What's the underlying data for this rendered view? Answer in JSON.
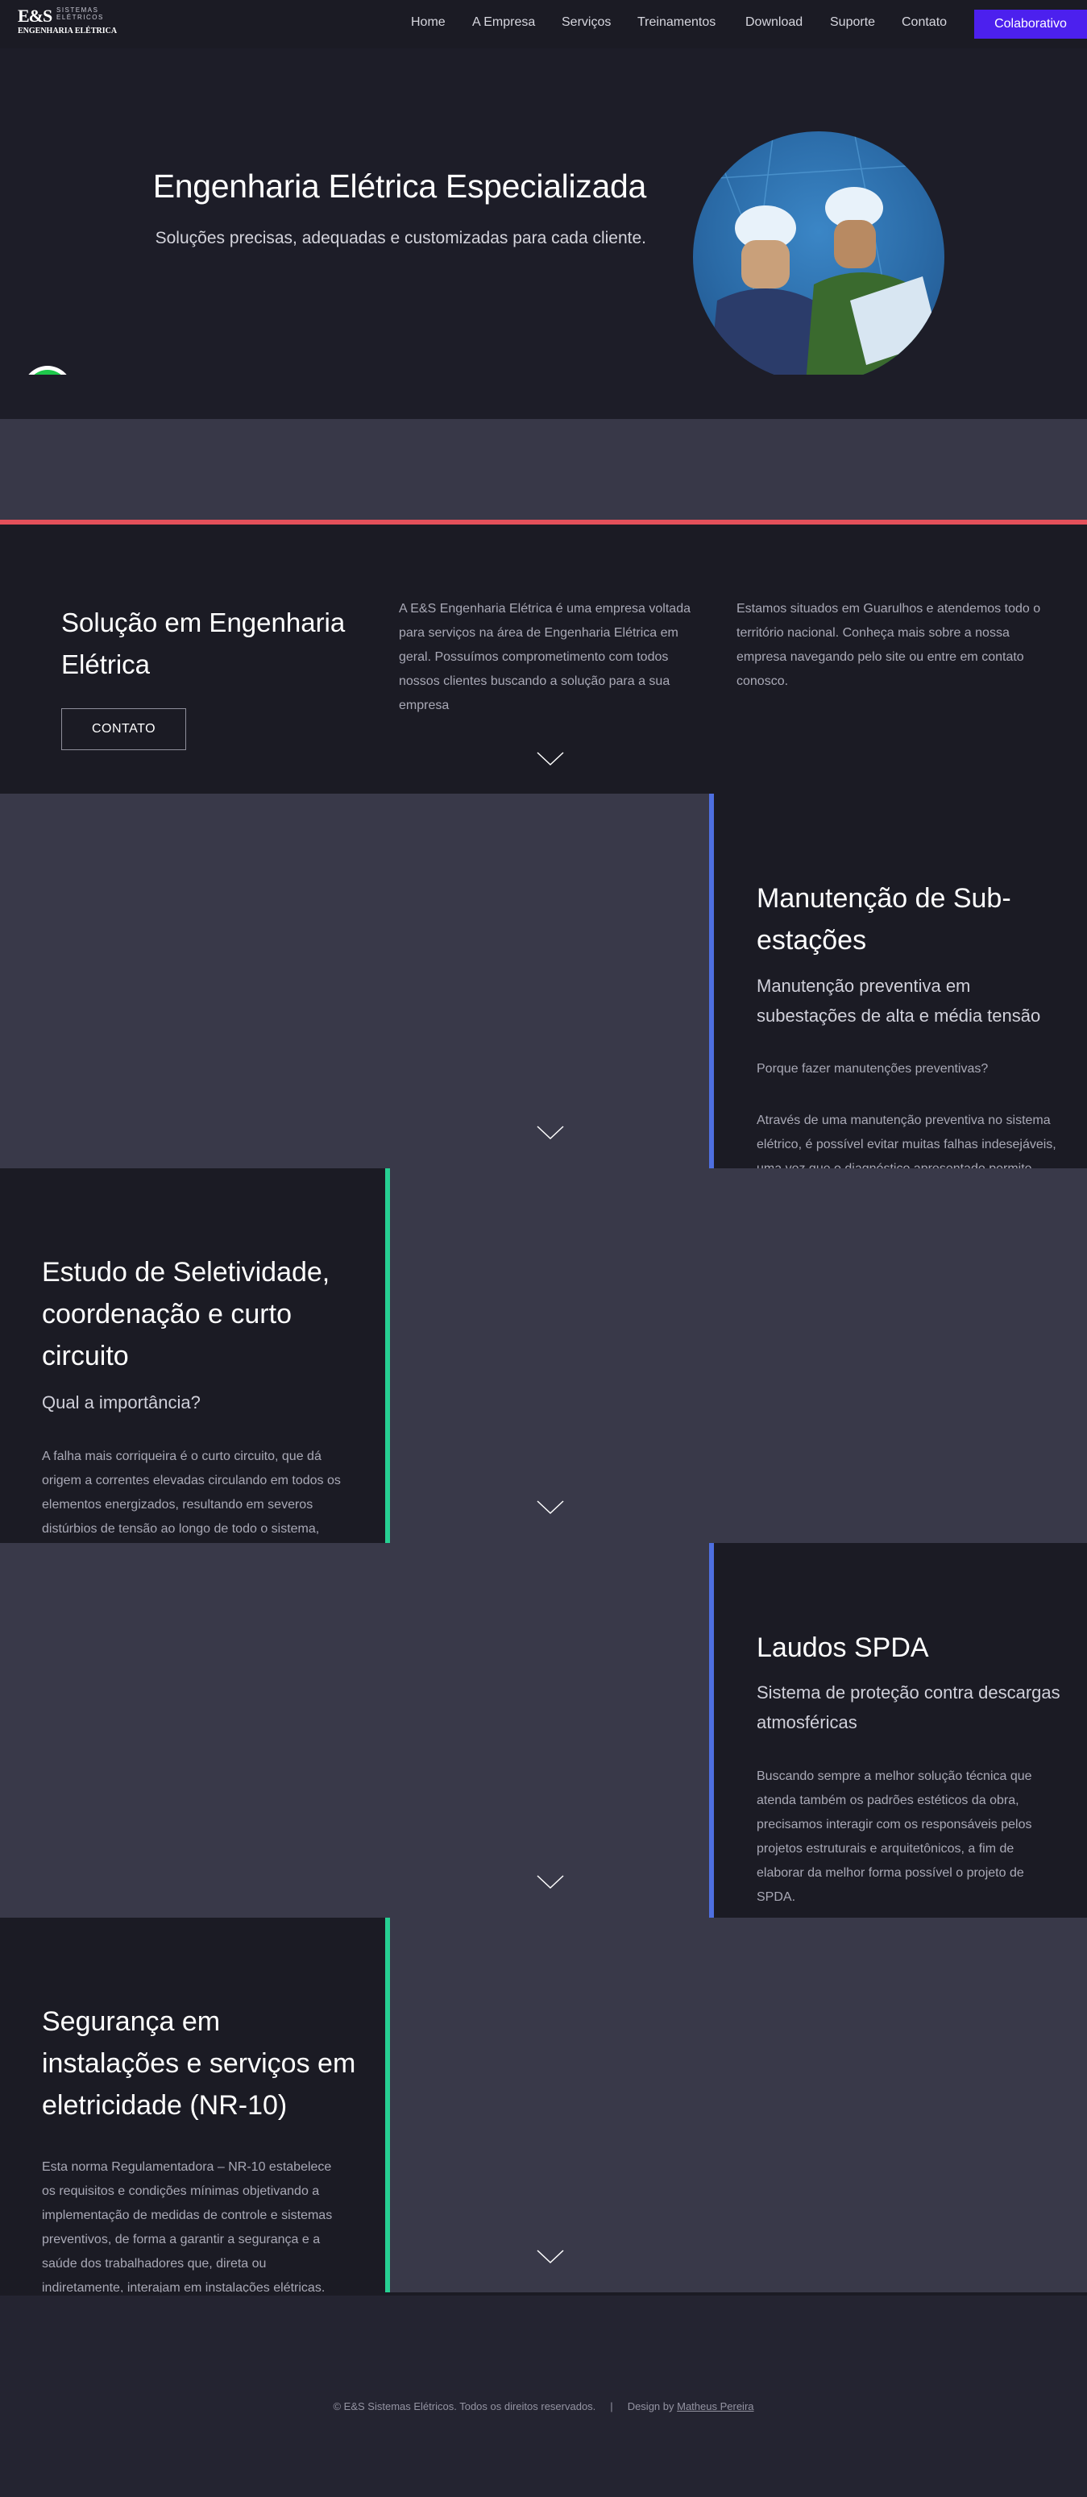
{
  "brand": {
    "logo_main": "E&S",
    "logo_line1": "SISTEMAS",
    "logo_line2": "ELÉTRICOS",
    "logo_tagline": "ENGENHARIA ELÉTRICA"
  },
  "nav": {
    "items": [
      "Home",
      "A Empresa",
      "Serviços",
      "Treinamentos",
      "Download",
      "Suporte",
      "Contato"
    ],
    "cta": "Colaborativo"
  },
  "hero": {
    "title": "Engenharia Elétrica Especializada",
    "subtitle": "Soluções precisas, adequadas e customizadas para cada cliente."
  },
  "solution": {
    "title": "Solução em Engenharia Elétrica",
    "button": "CONTATO",
    "col1": "A E&S Engenharia Elétrica é uma empresa voltada para serviços na área de Engenharia Elétrica em geral. Possuímos comprometimento com todos nossos clientes buscando a solução para a sua empresa",
    "col2": "Estamos situados em Guarulhos e atendemos todo o território nacional. Conheça mais sobre a nossa empresa navegando pelo site ou entre em contato conosco."
  },
  "services": [
    {
      "title": "Manutenção de Sub-estações",
      "subtitle": "Manutenção preventiva em subestações de alta e média tensão",
      "question": "Porque fazer manutenções preventivas?",
      "text": "Através de uma manutenção preventiva no sistema elétrico, é possível evitar muitas falhas indesejáveis, uma vez que o diagnóstico apresentado permite corrigir problemas antes que se tornem graves."
    },
    {
      "title": "Estudo de Seletividade, coordenação e curto circuito",
      "subtitle": "Qual a importância?",
      "text": "A falha mais corriqueira é o curto circuito, que dá origem a correntes elevadas circulando em todos os elementos energizados, resultando em severos distúrbios de tensão ao longo de todo o sistema, podendo causar danos irreparáveis."
    },
    {
      "title": "Laudos SPDA",
      "subtitle": "Sistema de proteção contra descargas atmosféricas",
      "text": "Buscando sempre a melhor solução técnica que atenda também os padrões estéticos da obra, precisamos interagir com os responsáveis pelos projetos estruturais e arquitetônicos, a fim de elaborar da melhor forma possível o projeto de SPDA."
    },
    {
      "title": "Segurança em instalações e serviços em eletricidade (NR-10)",
      "text": "Esta norma Regulamentadora – NR-10 estabelece os requisitos e condições mínimas objetivando a implementação de medidas de controle e sistemas preventivos, de forma a garantir a segurança e a saúde dos trabalhadores que, direta ou indiretamente, interajam em instalações elétricas."
    }
  ],
  "footer": {
    "copyright": "© E&S Sistemas Elétricos. Todos os direitos reservados.",
    "design_prefix": "Design by",
    "designer": "Matheus Pereira"
  },
  "icons": {
    "whatsapp": "whatsapp-icon",
    "scroll": "chevron-down-icon"
  },
  "colors": {
    "accent": "#4c20ee",
    "red_divider": "#e4505a",
    "blue_bar": "#4e6fe0",
    "green_bar": "#27d093",
    "whatsapp": "#1ec84b"
  }
}
